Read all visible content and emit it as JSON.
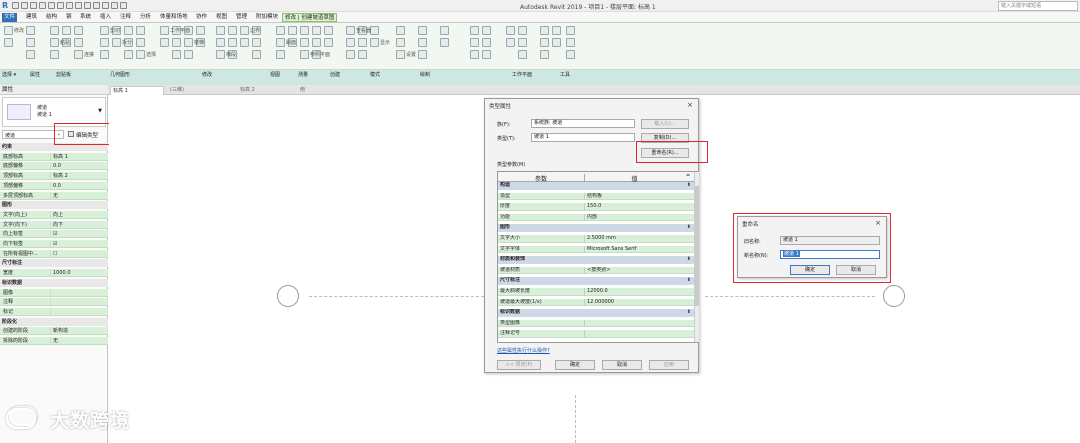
{
  "app": {
    "title": "Autodesk Revit 2019 - 项目1 - 楼层平面: 标高 1",
    "search_placeholder": "键入关键字或短语"
  },
  "menu_tabs": [
    {
      "label": "文件",
      "kind": "file"
    },
    {
      "label": "建筑"
    },
    {
      "label": "结构"
    },
    {
      "label": "钢"
    },
    {
      "label": "系统"
    },
    {
      "label": "插入"
    },
    {
      "label": "注释"
    },
    {
      "label": "分析"
    },
    {
      "label": "体量和场地"
    },
    {
      "label": "协作"
    },
    {
      "label": "视图"
    },
    {
      "label": "管理"
    },
    {
      "label": "附加模块"
    },
    {
      "label": "修改 | 创建坡道草图",
      "kind": "contextual"
    }
  ],
  "ribbon": {
    "panel_labels": [
      "选择 ▾",
      "属性",
      "剪贴板",
      "几何图形",
      "修改",
      "视图",
      "测量",
      "创建",
      "模式",
      "绘制",
      "工作平面",
      "工具"
    ],
    "small_labels": [
      "修改",
      "粘贴",
      "连接",
      "剪切",
      "拆分",
      "选择",
      "工作平面",
      "楼梯",
      "梯段",
      "边界",
      "踢面",
      "参照平面",
      "查看器",
      "显示",
      "设置"
    ]
  },
  "view_tabs": [
    {
      "label": "标高 1",
      "active": true
    },
    {
      "label": "(三维)"
    },
    {
      "label": "标高 2"
    },
    {
      "label": "南"
    }
  ],
  "properties": {
    "header": "属性",
    "type_name": "坡道",
    "type_subname": "坡道 1",
    "selector": "坡道",
    "edit_type_label": "编辑类型",
    "rows": [
      {
        "kind": "cat",
        "key": "约束"
      },
      {
        "kind": "item",
        "key": "底部标高",
        "value": "标高 1"
      },
      {
        "kind": "item",
        "key": "底部偏移",
        "value": "0.0"
      },
      {
        "kind": "item",
        "key": "顶部标高",
        "value": "标高 2"
      },
      {
        "kind": "item",
        "key": "顶部偏移",
        "value": "0.0"
      },
      {
        "kind": "item",
        "key": "多层顶部标高",
        "value": "无"
      },
      {
        "kind": "cat",
        "key": "图形"
      },
      {
        "kind": "item",
        "key": "文字(向上)",
        "value": "向上"
      },
      {
        "kind": "item",
        "key": "文字(向下)",
        "value": "向下"
      },
      {
        "kind": "item",
        "key": "向上标签",
        "value": "☑"
      },
      {
        "kind": "item",
        "key": "向下标签",
        "value": "☑"
      },
      {
        "kind": "item",
        "key": "在所有视图中...",
        "value": "☐"
      },
      {
        "kind": "cat",
        "key": "尺寸标注"
      },
      {
        "kind": "item",
        "key": "宽度",
        "value": "1000.0"
      },
      {
        "kind": "cat",
        "key": "标识数据"
      },
      {
        "kind": "item",
        "key": "图像",
        "value": ""
      },
      {
        "kind": "item",
        "key": "注释",
        "value": ""
      },
      {
        "kind": "item",
        "key": "标记",
        "value": ""
      },
      {
        "kind": "cat",
        "key": "阶段化"
      },
      {
        "kind": "item",
        "key": "创建的阶段",
        "value": "新构造"
      },
      {
        "kind": "item",
        "key": "拆除的阶段",
        "value": "无"
      }
    ]
  },
  "type_dialog": {
    "title": "类型属性",
    "family_label": "族(F):",
    "family_value": "系统族: 坡道",
    "type_label": "类型(T):",
    "type_value": "坡道 1",
    "load_button": "载入(L)...",
    "duplicate_button": "复制(D)...",
    "rename_button": "重命名(R)...",
    "params_label": "类型参数(M)",
    "col_param": "参数",
    "col_value": "值",
    "rows": [
      {
        "kind": "cat",
        "key": "构造"
      },
      {
        "kind": "item",
        "key": "造型",
        "value": "结构板"
      },
      {
        "kind": "item",
        "key": "厚度",
        "value": "150.0"
      },
      {
        "kind": "item",
        "key": "功能",
        "value": "内部"
      },
      {
        "kind": "cat",
        "key": "图形"
      },
      {
        "kind": "item",
        "key": "文字大小",
        "value": "2.5000 mm"
      },
      {
        "kind": "item",
        "key": "文字字体",
        "value": "Microsoft Sans Serif"
      },
      {
        "kind": "cat",
        "key": "材质和装饰"
      },
      {
        "kind": "item",
        "key": "坡道材质",
        "value": "<按类别>"
      },
      {
        "kind": "cat",
        "key": "尺寸标注"
      },
      {
        "kind": "item",
        "key": "最大斜坡长度",
        "value": "12000.0"
      },
      {
        "kind": "item",
        "key": "坡道最大坡度(1/x)",
        "value": "12.000000"
      },
      {
        "kind": "cat",
        "key": "标识数据"
      },
      {
        "kind": "item",
        "key": "类型图像",
        "value": ""
      },
      {
        "kind": "item",
        "key": "注释记号",
        "value": ""
      }
    ],
    "help_link": "这些属性执行什么操作?",
    "preview_button": "<< 预览(P)",
    "ok_button": "确定",
    "cancel_button": "取消",
    "apply_button": "应用"
  },
  "rename_dialog": {
    "title": "重命名",
    "old_label": "旧名称:",
    "old_value": "坡道 1",
    "new_label": "新名称(N):",
    "new_value": "坡道 1",
    "ok_button": "确定",
    "cancel_button": "取消"
  },
  "watermark": "大数跨境",
  "colors": {
    "file_tab": "#2e6fb5",
    "property_green": "#d8efd8",
    "highlight_box": "#e0282a"
  }
}
